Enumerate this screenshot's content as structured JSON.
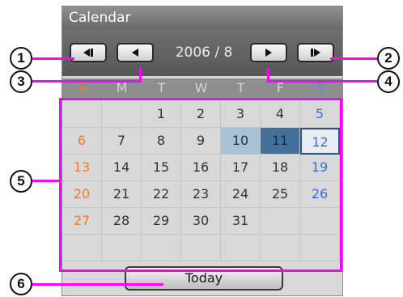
{
  "window": {
    "title": "Calendar"
  },
  "nav": {
    "year_month": "2006 / 8"
  },
  "weekdays": [
    "S",
    "M",
    "T",
    "W",
    "T",
    "F",
    "S"
  ],
  "days": [
    [
      "",
      "",
      "1",
      "2",
      "3",
      "4",
      "5"
    ],
    [
      "6",
      "7",
      "8",
      "9",
      "10",
      "11",
      "12"
    ],
    [
      "13",
      "14",
      "15",
      "16",
      "17",
      "18",
      "19"
    ],
    [
      "20",
      "21",
      "22",
      "23",
      "24",
      "25",
      "26"
    ],
    [
      "27",
      "28",
      "29",
      "30",
      "31",
      "",
      ""
    ],
    [
      "",
      "",
      "",
      "",
      "",
      "",
      ""
    ]
  ],
  "highlighted_days": {
    "light": "10",
    "selected": "11",
    "today": "12"
  },
  "today_button": {
    "label": "Today"
  },
  "callouts": [
    "1",
    "2",
    "3",
    "4",
    "5",
    "6"
  ],
  "colors": {
    "annotation": "#ff00ff",
    "sunday": "#ee7a2c",
    "saturday": "#3a6fd8",
    "selected": "#43719a",
    "previous_highlight": "#a7c1d6"
  }
}
